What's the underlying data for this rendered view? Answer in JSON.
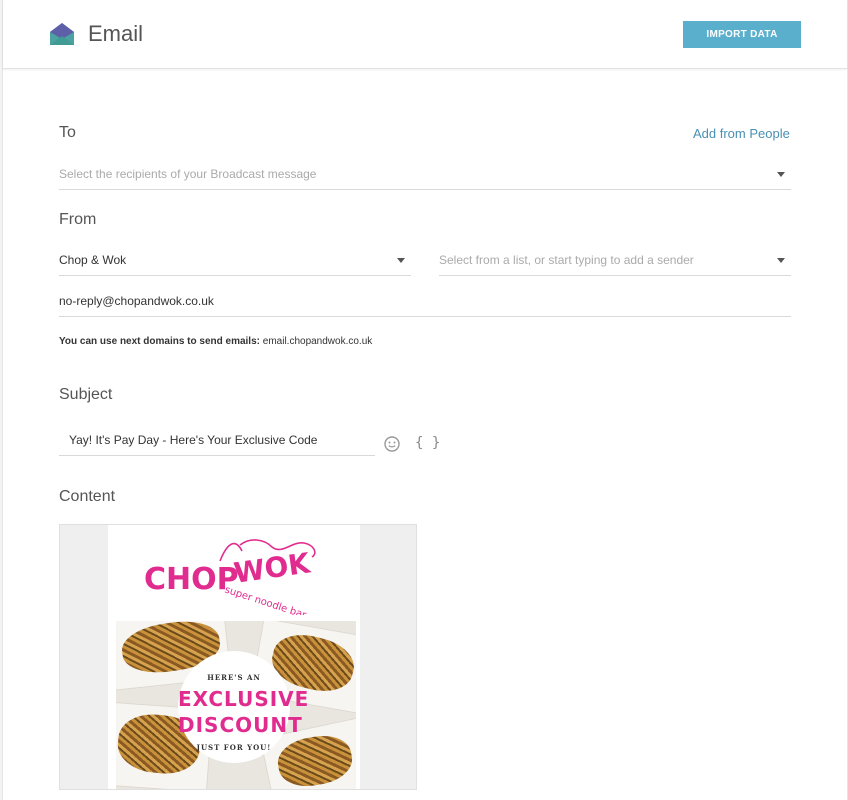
{
  "header": {
    "title": "Email",
    "import_label": "IMPORT DATA"
  },
  "to": {
    "label": "To",
    "add_link": "Add from People",
    "placeholder": "Select the recipients of your Broadcast message"
  },
  "from": {
    "label": "From",
    "sender_name": "Chop & Wok",
    "sender_placeholder": "Select from a list, or start typing to add a sender",
    "email": "no-reply@chopandwok.co.uk",
    "domains_note_bold": "You can use next domains to send emails:",
    "domains_note_value": "email.chopandwok.co.uk"
  },
  "subject": {
    "label": "Subject",
    "value": "Yay! It's Pay Day - Here's Your Exclusive Code",
    "emoji_icon": "smiley-icon",
    "merge_tag_icon": "braces-icon",
    "merge_tag_glyph": "{ }"
  },
  "content": {
    "label": "Content",
    "logo_text_left": "CHOP",
    "logo_text_right": "WOK",
    "logo_tagline": "super noodle bar",
    "badge_top": "HERE'S AN",
    "badge_line1": "EXCLUSIVE",
    "badge_line2": "DISCOUNT",
    "badge_bottom": "JUST FOR YOU!"
  },
  "colors": {
    "accent": "#5aafcd",
    "link": "#4a8fb3",
    "brand_pink": "#e12c8f"
  }
}
